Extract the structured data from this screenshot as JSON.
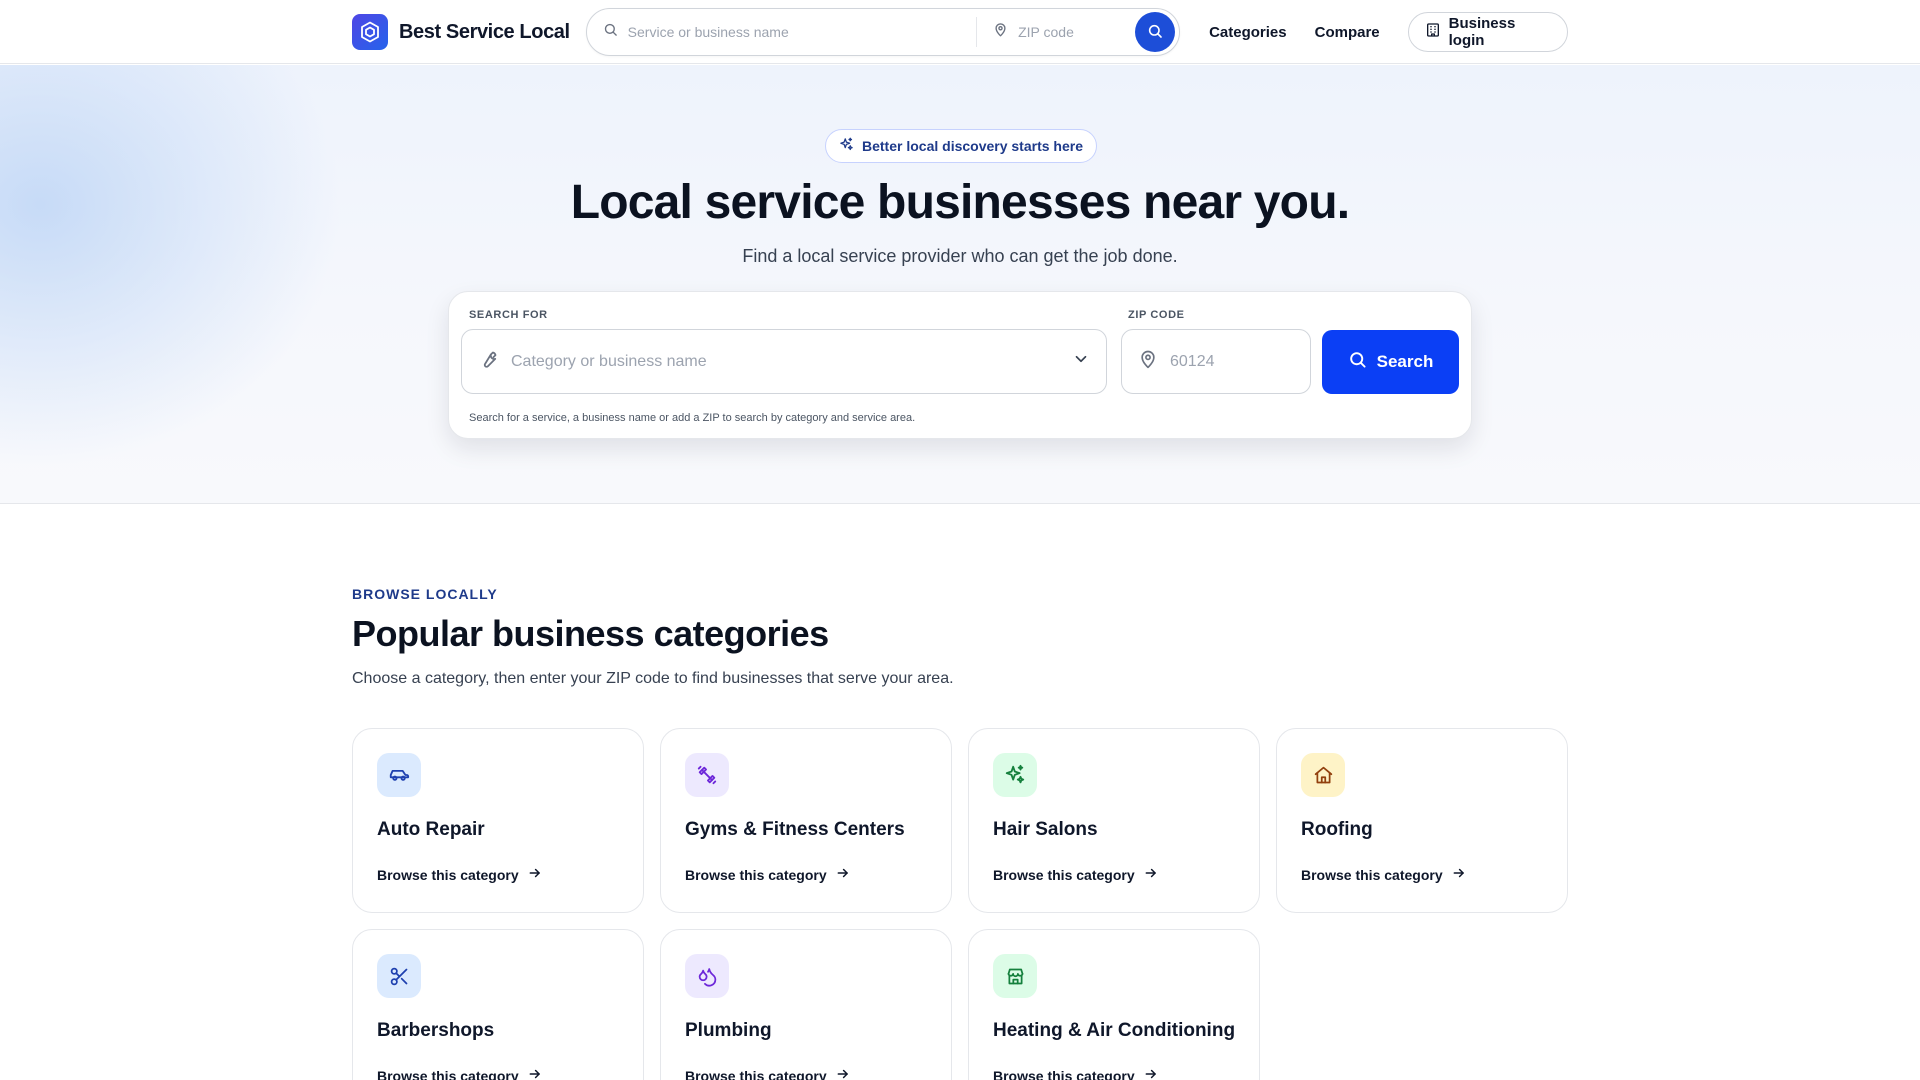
{
  "header": {
    "brand": "Best Service Local",
    "search_placeholder": "Service or business name",
    "zip_placeholder": "ZIP code",
    "nav": [
      {
        "label": "Categories"
      },
      {
        "label": "Compare"
      }
    ],
    "business_login": "Business login"
  },
  "hero": {
    "pill": "Better local discovery starts here",
    "title": "Local service businesses near you.",
    "subtitle": "Find a local service provider who can get the job done.",
    "search": {
      "search_for_label": "SEARCH FOR",
      "search_for_placeholder": "Category or business name",
      "zip_label": "ZIP CODE",
      "zip_placeholder": "60124",
      "button": "Search",
      "hint": "Search for a service, a business name or add a ZIP to search by category and service area."
    }
  },
  "categories": {
    "eyebrow": "BROWSE LOCALLY",
    "title": "Popular business categories",
    "subtitle": "Choose a category, then enter your ZIP code to find businesses that serve your area.",
    "link_label": "Browse this category",
    "items": [
      {
        "name": "Auto Repair",
        "icon": "car-icon",
        "icon_bg": "#dbeafe",
        "icon_color": "#1e40af"
      },
      {
        "name": "Gyms & Fitness Centers",
        "icon": "dumbbell-icon",
        "icon_bg": "#ede9fe",
        "icon_color": "#6d28d9"
      },
      {
        "name": "Hair Salons",
        "icon": "sparkles-icon",
        "icon_bg": "#dcfce7",
        "icon_color": "#15803d"
      },
      {
        "name": "Roofing",
        "icon": "house-icon",
        "icon_bg": "#fef3c7",
        "icon_color": "#92400e"
      },
      {
        "name": "Barbershops",
        "icon": "scissors-icon",
        "icon_bg": "#dbeafe",
        "icon_color": "#1e40af"
      },
      {
        "name": "Plumbing",
        "icon": "droplets-icon",
        "icon_bg": "#ede9fe",
        "icon_color": "#6d28d9"
      },
      {
        "name": "Heating & Air Conditioning",
        "icon": "store-icon",
        "icon_bg": "#dcfce7",
        "icon_color": "#15803d"
      }
    ]
  },
  "colors": {
    "primary": "#0b3ff5",
    "accent_text": "#1e3a8a"
  }
}
